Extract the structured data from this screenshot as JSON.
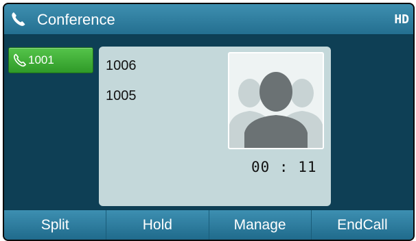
{
  "header": {
    "title": "Conference",
    "hd_badge": "HD",
    "icon": "phone-handset-icon"
  },
  "line_key": {
    "label": "1001",
    "icon": "phone-handset-icon",
    "color": "#3aa934"
  },
  "call": {
    "participants": [
      "1006",
      "1005"
    ],
    "duration": "00 : 11",
    "avatar_icon": "conference-contacts-icon"
  },
  "softkeys": [
    {
      "label": "Split"
    },
    {
      "label": "Hold"
    },
    {
      "label": "Manage"
    },
    {
      "label": "EndCall"
    }
  ],
  "colors": {
    "background": "#0e3f55",
    "title_bar": "#2f7fa0",
    "panel": "#c4d8da",
    "softkey_bar": "#2a7a9c"
  }
}
